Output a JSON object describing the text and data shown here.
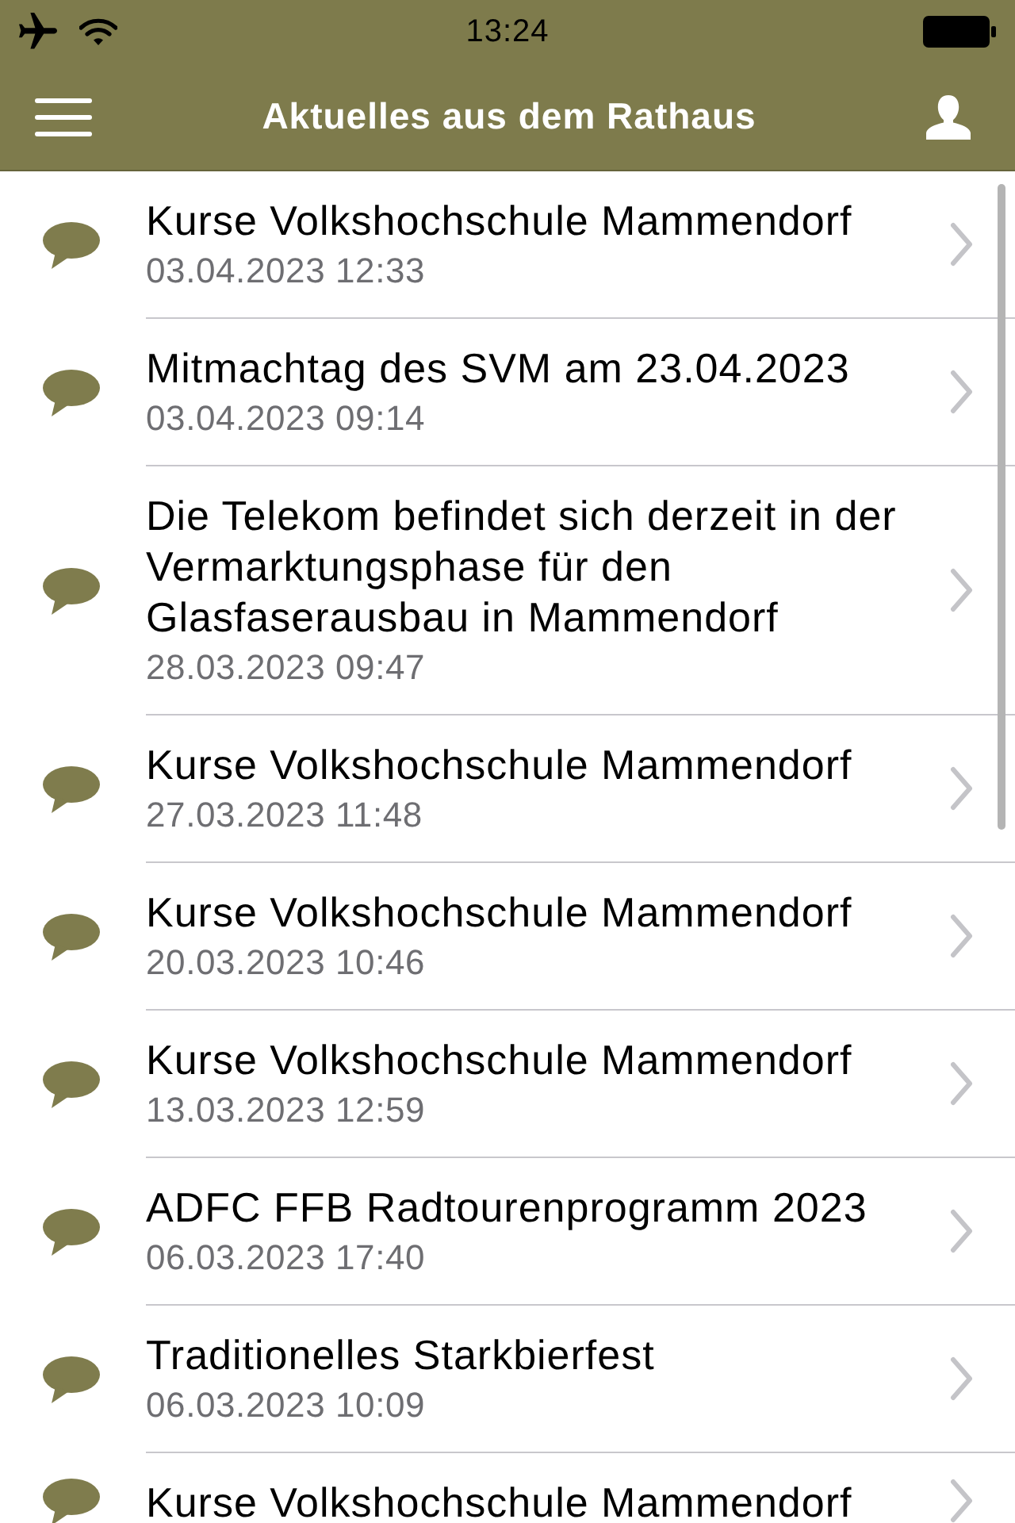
{
  "status_bar": {
    "time": "13:24"
  },
  "nav_bar": {
    "title": "Aktuelles aus dem Rathaus"
  },
  "news": [
    {
      "title": "Kurse Volkshochschule Mammendorf",
      "date": "03.04.2023 12:33"
    },
    {
      "title": "Mitmachtag des SVM am 23.04.2023",
      "date": "03.04.2023 09:14"
    },
    {
      "title": "Die Telekom befindet sich derzeit in der Vermarktungsphase für den Glasfaserausbau in Mammendorf",
      "date": "28.03.2023 09:47"
    },
    {
      "title": "Kurse Volkshochschule Mammendorf",
      "date": "27.03.2023 11:48"
    },
    {
      "title": "Kurse Volkshochschule Mammendorf",
      "date": "20.03.2023 10:46"
    },
    {
      "title": "Kurse Volkshochschule Mammendorf",
      "date": "13.03.2023 12:59"
    },
    {
      "title": "ADFC FFB Radtourenprogramm 2023",
      "date": "06.03.2023 17:40"
    },
    {
      "title": "Traditionelles Starkbierfest",
      "date": "06.03.2023 10:09"
    },
    {
      "title": "Kurse Volkshochschule Mammendorf"
    }
  ]
}
